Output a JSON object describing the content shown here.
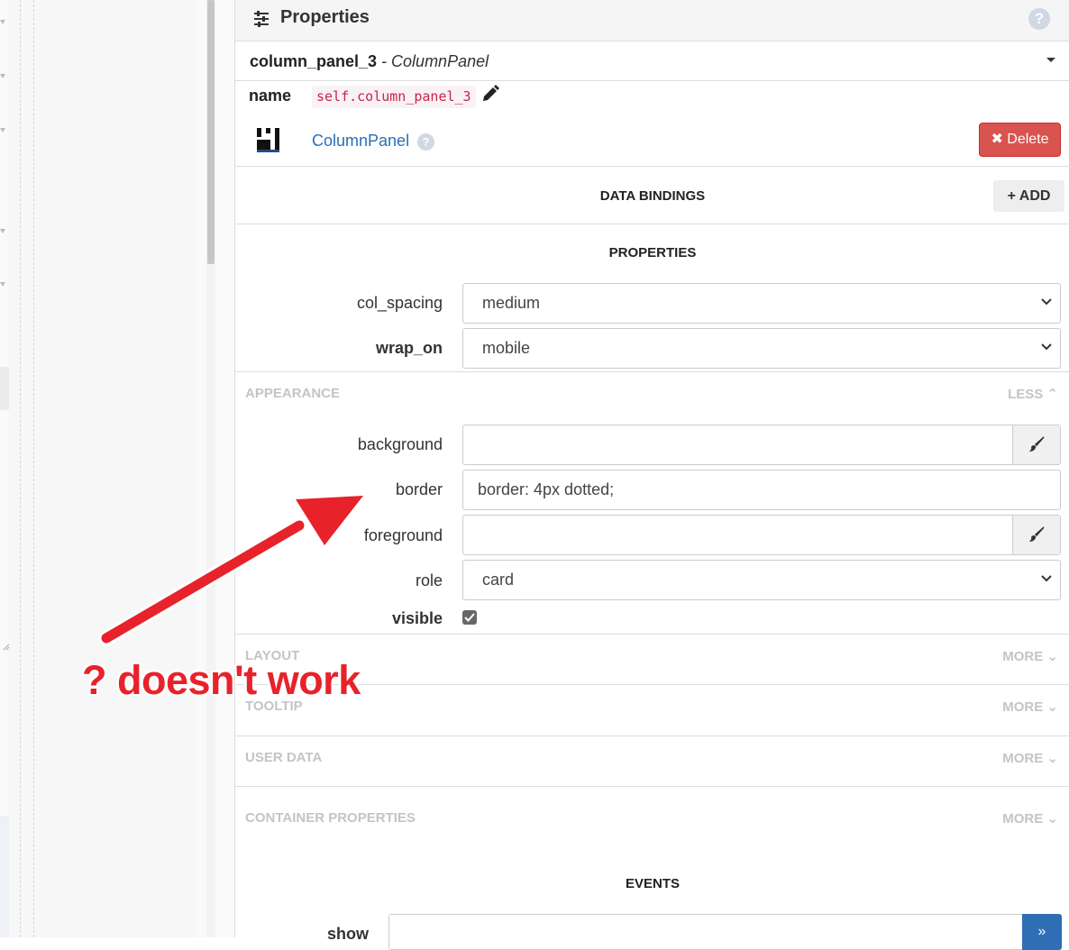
{
  "header": {
    "title": "Properties",
    "help": "?"
  },
  "component": {
    "name": "column_panel_3",
    "separator": " - ",
    "type": "ColumnPanel"
  },
  "name_field": {
    "label": "name",
    "value": "self.column_panel_3"
  },
  "type_link": {
    "label": "ColumnPanel",
    "help": "?"
  },
  "delete_button": {
    "label": "✖ Delete"
  },
  "data_bindings": {
    "title": "DATA BINDINGS",
    "add_label": "+ ADD"
  },
  "properties": {
    "title": "PROPERTIES",
    "col_spacing": {
      "label": "col_spacing",
      "value": "medium"
    },
    "wrap_on": {
      "label": "wrap_on",
      "value": "mobile"
    }
  },
  "appearance": {
    "title": "APPEARANCE",
    "toggle": "LESS ⌃",
    "background": {
      "label": "background",
      "value": ""
    },
    "border": {
      "label": "border",
      "value": "border: 4px dotted;"
    },
    "foreground": {
      "label": "foreground",
      "value": ""
    },
    "role": {
      "label": "role",
      "value": "card"
    },
    "visible": {
      "label": "visible",
      "checked": true
    }
  },
  "groups": [
    {
      "title": "LAYOUT",
      "toggle": "MORE ⌄"
    },
    {
      "title": "TOOLTIP",
      "toggle": "MORE ⌄"
    },
    {
      "title": "USER DATA",
      "toggle": "MORE ⌄"
    },
    {
      "title": "CONTAINER PROPERTIES",
      "toggle": "MORE ⌄"
    }
  ],
  "events": {
    "title": "EVENTS",
    "show_label": "show",
    "show_button": "»"
  },
  "annotation": {
    "text": "? doesn't work",
    "color": "#e8222a"
  },
  "colors": {
    "delete": "#d9534f",
    "link": "#2a6fb5",
    "code": "#c7254e",
    "muted": "#c4c4c4"
  }
}
